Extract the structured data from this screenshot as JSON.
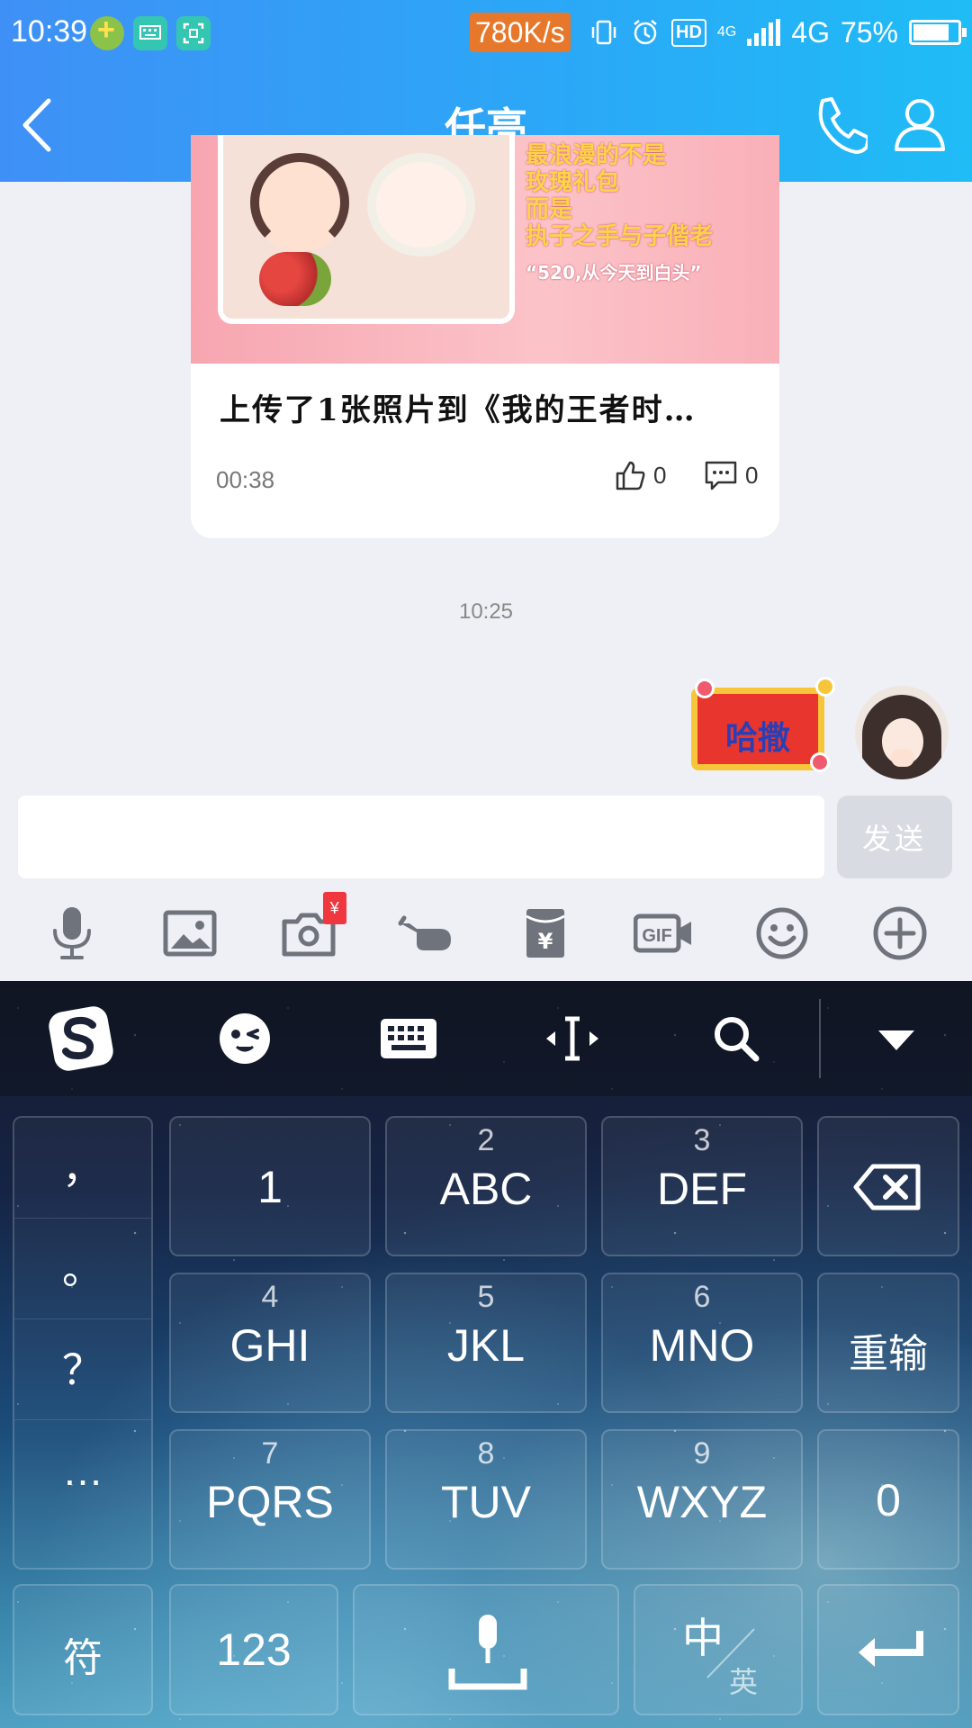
{
  "status_bar": {
    "time": "10:39",
    "net_speed": "780K/s",
    "hd": "HD",
    "network_small": "4G",
    "network": "4G",
    "battery": "75%"
  },
  "header": {
    "title": "任亮"
  },
  "post_card": {
    "slogan_lines": [
      "最浪漫的不是",
      "玫瑰礼包",
      "而是",
      "执子之手与子偕老"
    ],
    "slogan_quote": "“520,从今天到白头”",
    "title": "上传了1张照片到《我的王者时…",
    "time": "00:38",
    "likes": "0",
    "comments": "0"
  },
  "message_time": "10:25",
  "sticker": {
    "text": "哈撒"
  },
  "composer": {
    "input_value": "",
    "send_label": "发送"
  },
  "toolbar": {
    "red_packet_badge": "¥",
    "gif_label": "GIF",
    "icons": [
      "microphone-icon",
      "image-icon",
      "camera-icon",
      "poke-icon",
      "red-envelope-icon",
      "gif-icon",
      "emoji-icon",
      "plus-icon"
    ]
  },
  "keyboard": {
    "punctuation": [
      "，",
      "。",
      "？",
      "…"
    ],
    "keys": [
      {
        "num": "",
        "label": "1"
      },
      {
        "num": "2",
        "label": "ABC"
      },
      {
        "num": "3",
        "label": "DEF"
      },
      {
        "num": "4",
        "label": "GHI"
      },
      {
        "num": "5",
        "label": "JKL"
      },
      {
        "num": "6",
        "label": "MNO"
      },
      {
        "num": "7",
        "label": "PQRS"
      },
      {
        "num": "8",
        "label": "TUV"
      },
      {
        "num": "9",
        "label": "WXYZ"
      }
    ],
    "reset_label": "重输",
    "zero_label": "0",
    "symbol_label": "符",
    "numeric_label": "123",
    "lang_main": "中",
    "lang_sub": "英"
  }
}
